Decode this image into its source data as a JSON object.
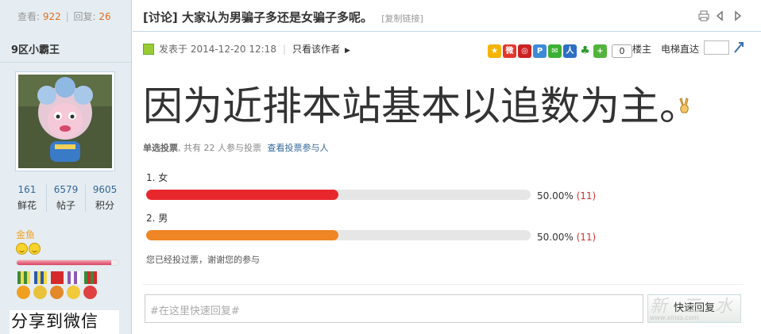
{
  "stats": {
    "views_label": "查看:",
    "views": "922",
    "replies_label": "回复:",
    "replies": "26"
  },
  "thread": {
    "category": "[讨论]",
    "title": "大家认为男骗子多还是女骗子多呢。",
    "copy_link": "[复制链接]"
  },
  "user": {
    "name": "9区小霸王",
    "counts": [
      {
        "value": "161",
        "label": "鲜花"
      },
      {
        "value": "6579",
        "label": "帖子"
      },
      {
        "value": "9605",
        "label": "积分"
      }
    ],
    "rank": "金鱼",
    "rank_progress": 0.93,
    "wechat": "分享到微信"
  },
  "post": {
    "posted_at": "发表于 2014-12-20 12:18",
    "only_author": "只看该作者",
    "share_count": "0",
    "floor": "楼主",
    "elevator": "电梯直达",
    "content": "因为近排本站基本以追数为主。"
  },
  "poll": {
    "type": "单选投票",
    "summary": ", 共有 22 人参与投票",
    "view_voters": "查看投票参与人",
    "options": [
      {
        "label": "1.  女",
        "percent_text": "50.00%",
        "count": "(11)",
        "fraction": 0.5,
        "color": "#e8272d"
      },
      {
        "label": "2.  男",
        "percent_text": "50.00%",
        "count": "(11)",
        "fraction": 0.5,
        "color": "#f08525"
      }
    ],
    "voted_note": "您已经投过票，谢谢您的参与"
  },
  "reply": {
    "placeholder": "#在这里快速回复#",
    "button": "快速回复"
  },
  "watermark": {
    "text": "新 三 水",
    "url": "www.xinss.com"
  }
}
